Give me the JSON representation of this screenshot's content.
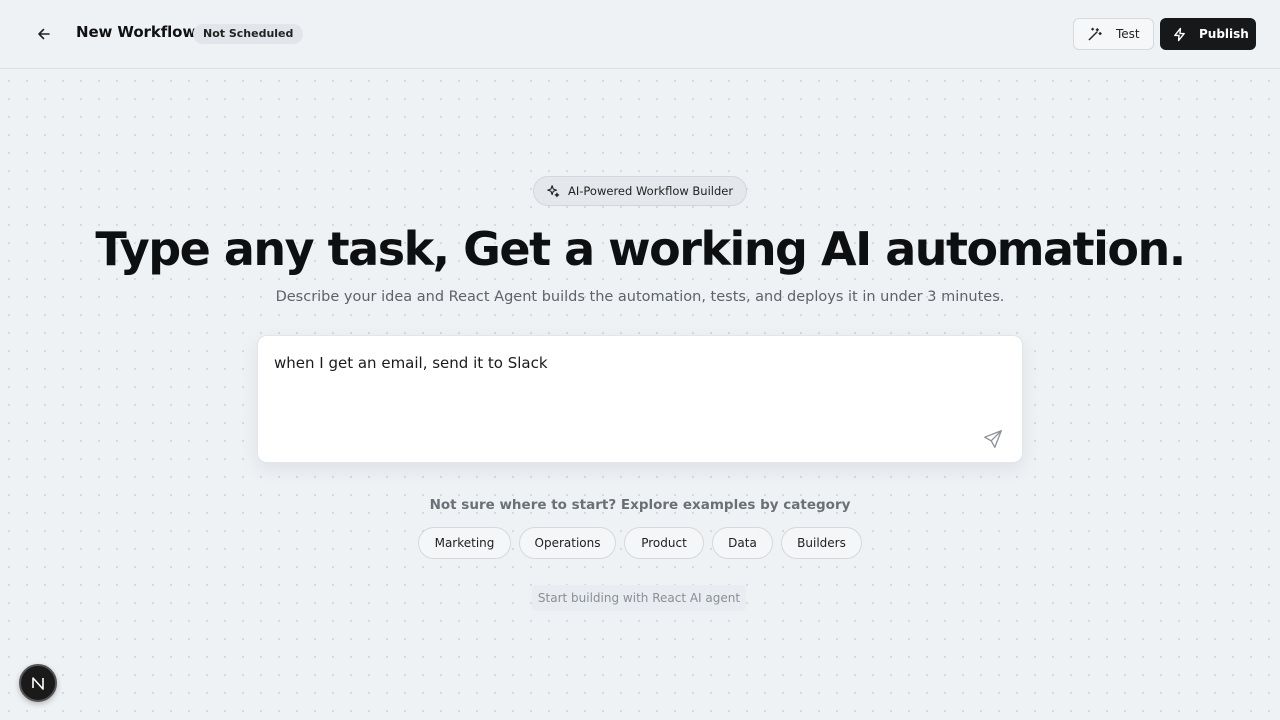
{
  "header": {
    "back_icon": "arrow-left-icon",
    "title": "New Workflow",
    "status": "Not Scheduled",
    "test_label": "Test",
    "test_icon": "magic-wand-icon",
    "publish_label": "Publish",
    "publish_icon": "lightning-icon"
  },
  "hero": {
    "badge_icon": "sparkles-icon",
    "badge": "AI-Powered Workflow Builder",
    "headline": "Type any task, Get a working AI automation.",
    "subhead": "Describe your idea and React Agent builds the automation, tests, and deploys it in under 3 minutes."
  },
  "prompt": {
    "value": "when I get an email, send it to Slack",
    "send_icon": "send-icon"
  },
  "examples": {
    "prompt": "Not sure where to start? Explore examples by category",
    "categories": [
      "Marketing",
      "Operations",
      "Product",
      "Data",
      "Builders"
    ]
  },
  "footer": {
    "note": "Start building with React AI agent",
    "badge_letter": "N"
  },
  "colors": {
    "background": "#eff2f5",
    "primary_button": "#17181a",
    "text": "#111111"
  }
}
